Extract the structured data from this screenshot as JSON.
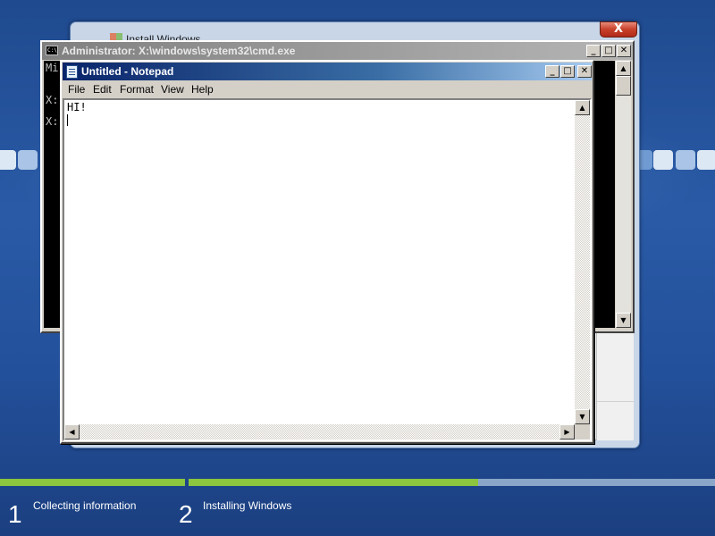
{
  "install_window": {
    "title": "Install Windows",
    "close_label": "X"
  },
  "cmd_window": {
    "title": "Administrator: X:\\windows\\system32\\cmd.exe",
    "icon_text": "C:\\",
    "lines": [
      "Mi",
      "X:",
      "X:"
    ],
    "buttons": {
      "minimize": "_",
      "maximize": "□",
      "close": "✕"
    }
  },
  "notepad": {
    "title": "Untitled - Notepad",
    "menu": [
      "File",
      "Edit",
      "Format",
      "View",
      "Help"
    ],
    "content": "HI!",
    "buttons": {
      "minimize": "_",
      "maximize": "□",
      "close": "✕"
    }
  },
  "progress": {
    "steps": [
      {
        "number": "1",
        "label": "Collecting information",
        "progress": 1.0
      },
      {
        "number": "2",
        "label": "Installing Windows",
        "progress": 0.55
      }
    ]
  },
  "colors": {
    "progress_green": "#8cc63f",
    "background_blue": "#23509a"
  }
}
